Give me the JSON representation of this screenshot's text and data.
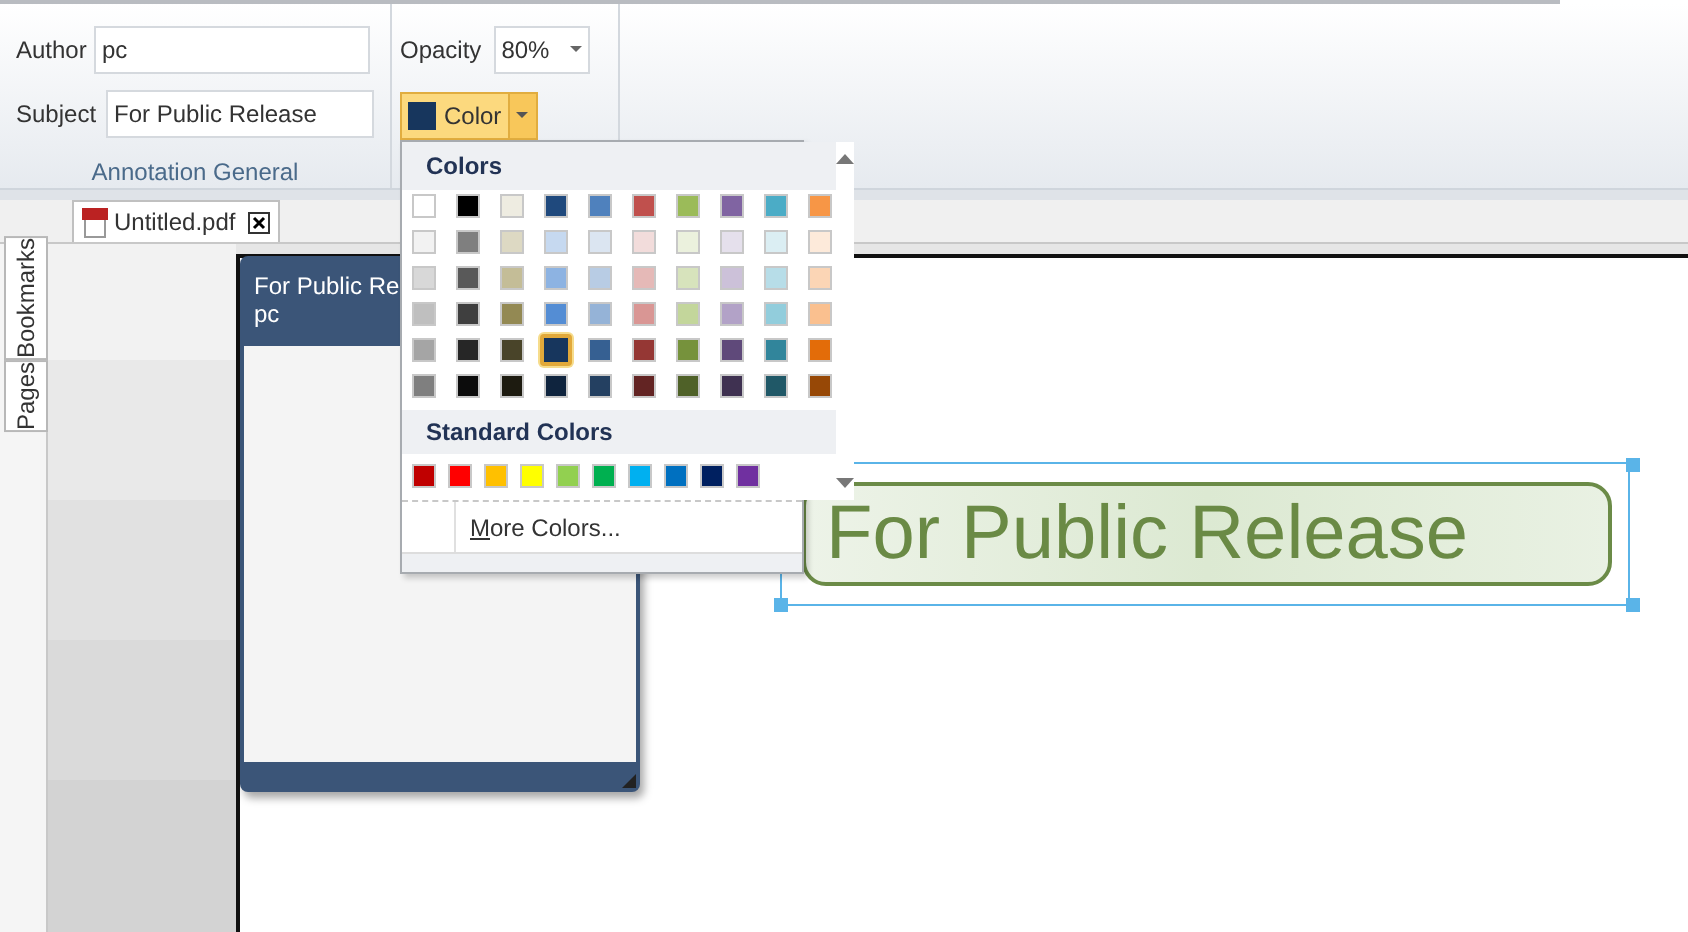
{
  "annotation_general": {
    "title": "Annotation General",
    "author": {
      "label": "Author",
      "value": "pc"
    },
    "subject": {
      "label": "Subject",
      "value": "For Public Release"
    }
  },
  "opacity": {
    "label": "Opacity",
    "value": "80%"
  },
  "color_button": {
    "label": "Color",
    "color": "#17365d",
    "expanded": true
  },
  "color_menu": {
    "theme_heading": "Colors",
    "theme_rows": [
      [
        {
          "color": "#ffffff",
          "selected": false
        },
        {
          "color": "#000000",
          "selected": false
        },
        {
          "color": "#eeece1",
          "selected": false
        },
        {
          "color": "#1f497d",
          "selected": false
        },
        {
          "color": "#4f81bd",
          "selected": false
        },
        {
          "color": "#c0504d",
          "selected": false
        },
        {
          "color": "#9bbb59",
          "selected": false
        },
        {
          "color": "#8064a2",
          "selected": false
        },
        {
          "color": "#4bacc6",
          "selected": false
        },
        {
          "color": "#f79646",
          "selected": false
        }
      ],
      [
        {
          "color": "#f2f2f2",
          "selected": false
        },
        {
          "color": "#7f7f7f",
          "selected": false
        },
        {
          "color": "#ddd9c3",
          "selected": false
        },
        {
          "color": "#c6d9f0",
          "selected": false
        },
        {
          "color": "#dbe5f1",
          "selected": false
        },
        {
          "color": "#f2dcdb",
          "selected": false
        },
        {
          "color": "#ebf1dd",
          "selected": false
        },
        {
          "color": "#e5e0ec",
          "selected": false
        },
        {
          "color": "#dbeef3",
          "selected": false
        },
        {
          "color": "#fdeada",
          "selected": false
        }
      ],
      [
        {
          "color": "#d8d8d8",
          "selected": false
        },
        {
          "color": "#595959",
          "selected": false
        },
        {
          "color": "#c4bd97",
          "selected": false
        },
        {
          "color": "#8db3e2",
          "selected": false
        },
        {
          "color": "#b8cce4",
          "selected": false
        },
        {
          "color": "#e5b9b7",
          "selected": false
        },
        {
          "color": "#d7e3bc",
          "selected": false
        },
        {
          "color": "#ccc1d9",
          "selected": false
        },
        {
          "color": "#b7dde8",
          "selected": false
        },
        {
          "color": "#fbd5b5",
          "selected": false
        }
      ],
      [
        {
          "color": "#bfbfbf",
          "selected": false
        },
        {
          "color": "#3f3f3f",
          "selected": false
        },
        {
          "color": "#938953",
          "selected": false
        },
        {
          "color": "#548dd4",
          "selected": false
        },
        {
          "color": "#95b3d7",
          "selected": false
        },
        {
          "color": "#d99694",
          "selected": false
        },
        {
          "color": "#c3d69b",
          "selected": false
        },
        {
          "color": "#b2a2c7",
          "selected": false
        },
        {
          "color": "#92cddc",
          "selected": false
        },
        {
          "color": "#fac08f",
          "selected": false
        }
      ],
      [
        {
          "color": "#a5a5a5",
          "selected": false
        },
        {
          "color": "#262626",
          "selected": false
        },
        {
          "color": "#494429",
          "selected": false
        },
        {
          "color": "#17365d",
          "selected": true
        },
        {
          "color": "#366092",
          "selected": false
        },
        {
          "color": "#953734",
          "selected": false
        },
        {
          "color": "#76923c",
          "selected": false
        },
        {
          "color": "#5f497a",
          "selected": false
        },
        {
          "color": "#31859b",
          "selected": false
        },
        {
          "color": "#e36c09",
          "selected": false
        }
      ],
      [
        {
          "color": "#7f7f7f",
          "selected": false
        },
        {
          "color": "#0c0c0c",
          "selected": false
        },
        {
          "color": "#1d1b10",
          "selected": false
        },
        {
          "color": "#0f243e",
          "selected": false
        },
        {
          "color": "#244061",
          "selected": false
        },
        {
          "color": "#632423",
          "selected": false
        },
        {
          "color": "#4f6128",
          "selected": false
        },
        {
          "color": "#3f3151",
          "selected": false
        },
        {
          "color": "#205867",
          "selected": false
        },
        {
          "color": "#974806",
          "selected": false
        }
      ]
    ],
    "standard_heading": "Standard Colors",
    "standard_colors": [
      {
        "color": "#c00000",
        "selected": false
      },
      {
        "color": "#ff0000",
        "selected": false
      },
      {
        "color": "#ffc000",
        "selected": false
      },
      {
        "color": "#ffff00",
        "selected": false
      },
      {
        "color": "#92d050",
        "selected": false
      },
      {
        "color": "#00b050",
        "selected": false
      },
      {
        "color": "#00b0f0",
        "selected": false
      },
      {
        "color": "#0070c0",
        "selected": false
      },
      {
        "color": "#002060",
        "selected": false
      },
      {
        "color": "#7030a0",
        "selected": false
      }
    ],
    "more_colors": "More Colors..."
  },
  "document_tabs": [
    {
      "label": "Untitled.pdf",
      "selected": true
    }
  ],
  "side_tabs": [
    {
      "label": "Bookmarks"
    },
    {
      "label": "Pages"
    }
  ],
  "popup_note": {
    "title": "For Public Re",
    "author": "pc"
  },
  "stamp": {
    "text": "For Public Release",
    "selected": true
  }
}
